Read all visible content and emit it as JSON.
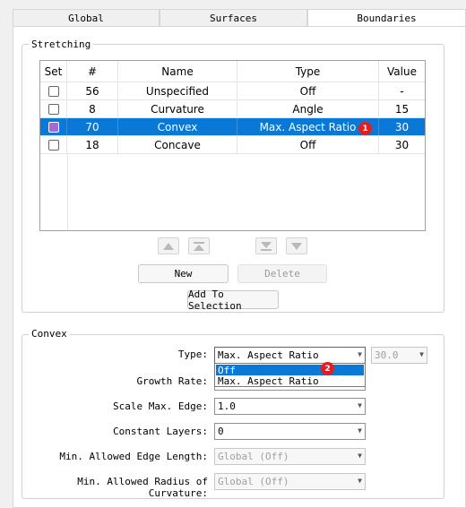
{
  "tabs": [
    {
      "label": "Global",
      "active": false
    },
    {
      "label": "Surfaces",
      "active": false
    },
    {
      "label": "Boundaries",
      "active": true
    }
  ],
  "stretching": {
    "title": "Stretching",
    "columns": [
      "Set",
      "#",
      "Name",
      "Type",
      "Value"
    ],
    "rows": [
      {
        "id": "56",
        "name": "Unspecified",
        "type": "Off",
        "value": "-",
        "selected": false
      },
      {
        "id": "8",
        "name": "Curvature",
        "type": "Angle",
        "value": "15",
        "selected": false
      },
      {
        "id": "70",
        "name": "Convex",
        "type": "Max. Aspect Ratio",
        "value": "30",
        "selected": true
      },
      {
        "id": "18",
        "name": "Concave",
        "type": "Off",
        "value": "30",
        "selected": false
      }
    ],
    "arrow_buttons": [
      "move-up-icon",
      "move-top-icon",
      "move-bottom-icon",
      "move-down-icon"
    ],
    "new_label": "New",
    "delete_label": "Delete",
    "add_selection_label": "Add To Selection"
  },
  "convex": {
    "title": "Convex",
    "type_label": "Type:",
    "type_value": "Max. Aspect Ratio",
    "type_numeric": "30.0",
    "growth_label": "Growth Rate:",
    "scale_label": "Scale Max. Edge:",
    "scale_value": "1.0",
    "layers_label": "Constant Layers:",
    "layers_value": "0",
    "min_edge_label": "Min. Allowed Edge Length:",
    "min_edge_value": "Global (Off)",
    "min_radius_label": "Min. Allowed Radius of Curvature:",
    "min_radius_value": "Global (Off)"
  },
  "dropdown": {
    "options": [
      "Off",
      "Max. Aspect Ratio"
    ],
    "highlighted": "Off"
  },
  "markers": [
    "1",
    "2"
  ],
  "colors": {
    "selection": "#0a78d7",
    "badge": "#e02020",
    "checkbox_selected": "#a56ad6"
  }
}
